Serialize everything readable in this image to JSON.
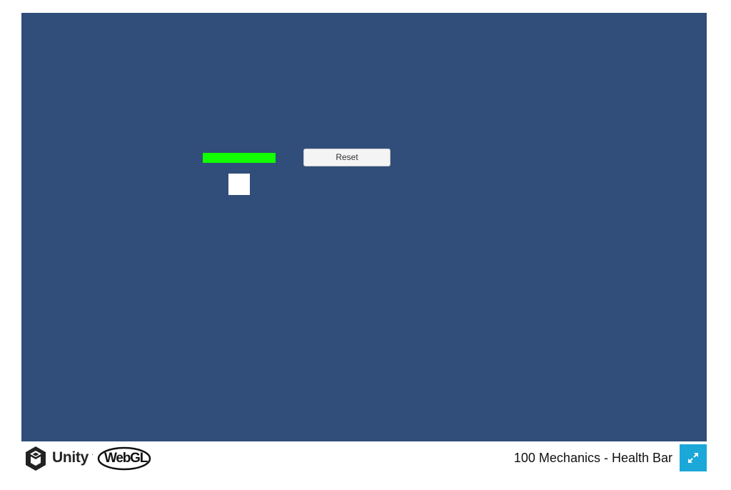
{
  "game": {
    "health_bar": {
      "level": 1.0,
      "fill_color": "#11ff00",
      "background_color": "#313131"
    },
    "reset_label": "Reset",
    "player_color": "#ffffff",
    "background_color": "#314d79"
  },
  "footer": {
    "unity_logo": "unity-cube-icon",
    "unity_label": "Unity",
    "webgl_label": "WebGL",
    "title": "100 Mechanics - Health Bar",
    "fullscreen_icon": "expand-arrows-icon",
    "accent_color": "#1ba7d8"
  }
}
